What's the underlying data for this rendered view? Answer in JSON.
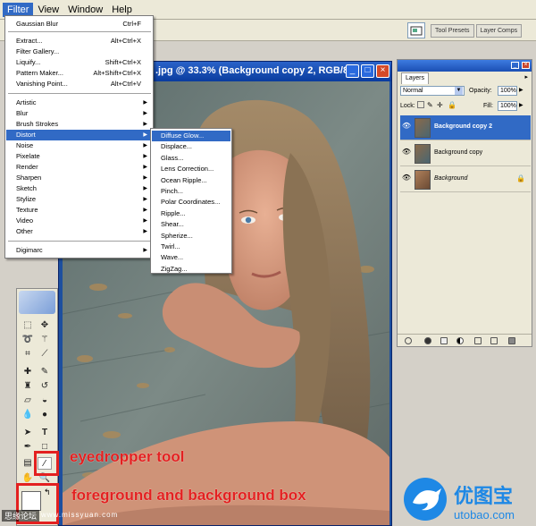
{
  "menubar": {
    "items": [
      "Filter",
      "View",
      "Window",
      "Help"
    ],
    "active_index": 0
  },
  "options_bar": {
    "tabs": [
      "Tool Presets",
      "Layer Comps"
    ]
  },
  "document": {
    "title": ".jpg @ 33.3% (Background copy 2, RGB/8)",
    "buttons": {
      "minimize": "_",
      "maximize": "□",
      "close": "×"
    }
  },
  "filter_menu": {
    "items": [
      {
        "label": "Gaussian Blur",
        "shortcut": "Ctrl+F"
      },
      {
        "label": "Extract...",
        "shortcut": "Alt+Ctrl+X"
      },
      {
        "label": "Filter Gallery...",
        "shortcut": ""
      },
      {
        "label": "Liquify...",
        "shortcut": "Shift+Ctrl+X"
      },
      {
        "label": "Pattern Maker...",
        "shortcut": "Alt+Shift+Ctrl+X"
      },
      {
        "label": "Vanishing Point...",
        "shortcut": "Alt+Ctrl+V"
      },
      {
        "label": "Artistic",
        "shortcut": ""
      },
      {
        "label": "Blur",
        "shortcut": ""
      },
      {
        "label": "Brush Strokes",
        "shortcut": ""
      },
      {
        "label": "Distort",
        "shortcut": ""
      },
      {
        "label": "Noise",
        "shortcut": ""
      },
      {
        "label": "Pixelate",
        "shortcut": ""
      },
      {
        "label": "Render",
        "shortcut": ""
      },
      {
        "label": "Sharpen",
        "shortcut": ""
      },
      {
        "label": "Sketch",
        "shortcut": ""
      },
      {
        "label": "Stylize",
        "shortcut": ""
      },
      {
        "label": "Texture",
        "shortcut": ""
      },
      {
        "label": "Video",
        "shortcut": ""
      },
      {
        "label": "Other",
        "shortcut": ""
      },
      {
        "label": "Digimarc",
        "shortcut": ""
      }
    ],
    "highlighted": "Distort"
  },
  "distort_submenu": {
    "items": [
      "Diffuse Glow...",
      "Displace...",
      "Glass...",
      "Lens Correction...",
      "Ocean Ripple...",
      "Pinch...",
      "Polar Coordinates...",
      "Ripple...",
      "Shear...",
      "Spherize...",
      "Twirl...",
      "Wave...",
      "ZigZag..."
    ],
    "highlighted": "Diffuse Glow..."
  },
  "layers_panel": {
    "tab": "Layers",
    "blend_mode": "Normal",
    "opacity_label": "Opacity:",
    "opacity_value": "100%",
    "lock_label": "Lock:",
    "fill_label": "Fill:",
    "fill_value": "100%",
    "layers": [
      {
        "name": "Background copy 2",
        "selected": true
      },
      {
        "name": "Background copy",
        "selected": false
      },
      {
        "name": "Background",
        "selected": false
      }
    ]
  },
  "annotations": {
    "eyedropper": "eyedropper tool",
    "fg_bg": "foreground and background box"
  },
  "watermarks": {
    "forum": "思缘论坛",
    "site": "www.missyuan.com",
    "logo_cn": "优图宝",
    "logo_url": "utobao.com"
  },
  "colors": {
    "highlight": "#316ac5",
    "annotation_red": "#e32020",
    "logo_blue": "#1e88e5"
  }
}
